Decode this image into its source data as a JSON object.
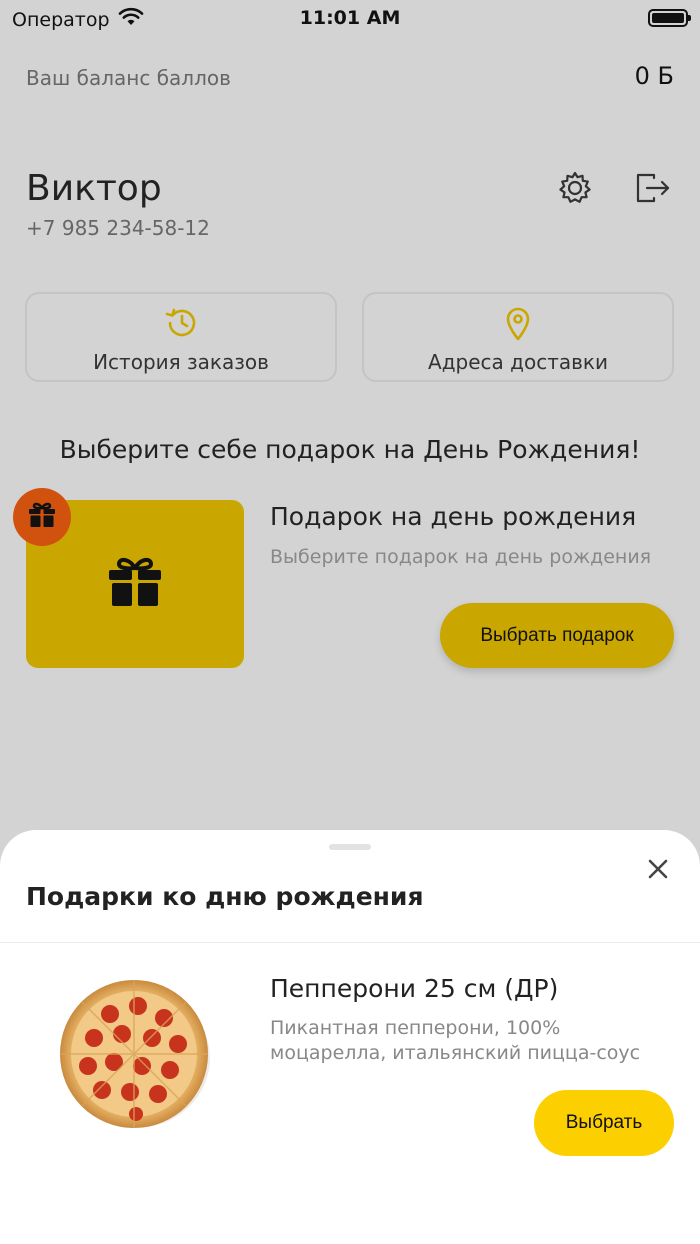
{
  "status_bar": {
    "carrier": "Оператор",
    "time": "11:01 AM",
    "battery_level": 1.0
  },
  "balance": {
    "label": "Ваш баланс баллов",
    "value": "0 Б"
  },
  "profile": {
    "name": "Виктор",
    "phone": "+7 985 234-58-12",
    "settings_icon": "gear-icon",
    "logout_icon": "logout-icon"
  },
  "cards": {
    "history": {
      "label": "История заказов",
      "icon": "history-icon"
    },
    "address": {
      "label": "Адреса доставки",
      "icon": "location-pin-icon"
    }
  },
  "birthday": {
    "heading": "Выберите себе подарок на День Рождения!",
    "title": "Подарок на день рождения",
    "subtitle": "Выберите подарок на день рождения",
    "button_label": "Выбрать подарок",
    "icon": "gift-icon"
  },
  "sheet": {
    "title": "Подарки ко дню рождения",
    "close_icon": "close-icon",
    "product": {
      "name": "Пепперони 25 см (ДР)",
      "description": "Пикантная пепперони, 100% моцарелла, итальянский пицца-соус",
      "button_label": "Выбрать",
      "image": "pepperoni-pizza"
    }
  },
  "colors": {
    "overlay_background": "#d3d3d3",
    "accent_dim": "#c9a700",
    "accent": "#fcd000",
    "badge": "#d1520f",
    "icon_gold": "#c9a700"
  }
}
